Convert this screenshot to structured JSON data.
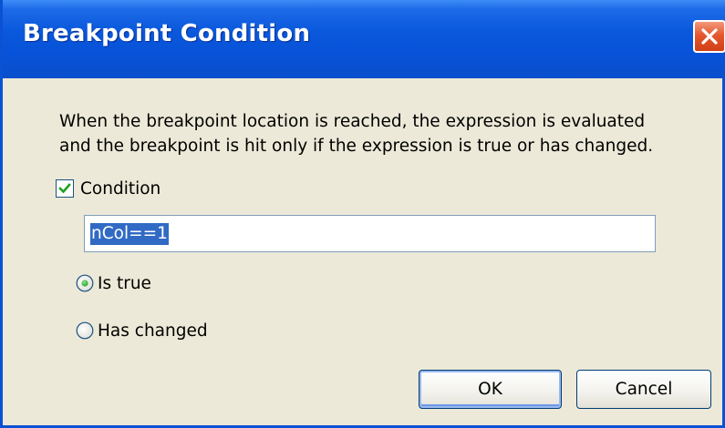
{
  "window": {
    "title": "Breakpoint Condition",
    "accent": "#0A58DC"
  },
  "description": {
    "line1": "When the breakpoint location is reached, the expression is evaluated",
    "line2": "and the breakpoint is hit only if the expression is true or has changed."
  },
  "condition": {
    "label": "Condition",
    "checked": true,
    "expression": "nCol==1"
  },
  "options": {
    "is_true": {
      "label": "Is true",
      "selected": true
    },
    "has_changed": {
      "label": "Has changed",
      "selected": false
    }
  },
  "buttons": {
    "ok": "OK",
    "cancel": "Cancel"
  },
  "icons": {
    "close": "close-icon",
    "check": "checkmark-icon"
  }
}
